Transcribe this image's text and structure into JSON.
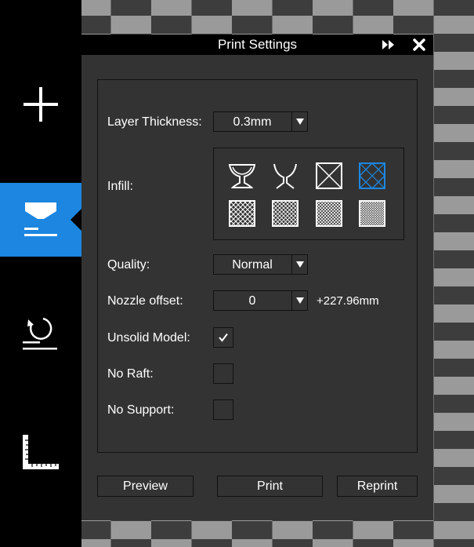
{
  "window": {
    "title": "Print Settings"
  },
  "sidebar": {
    "items": [
      {
        "icon": "plus-icon",
        "active": false
      },
      {
        "icon": "print-settings-icon",
        "active": true
      },
      {
        "icon": "reset-rotate-icon",
        "active": false
      },
      {
        "icon": "ruler-icon",
        "active": false
      }
    ]
  },
  "settings": {
    "layer_thickness": {
      "label": "Layer Thickness:",
      "value": "0.3mm"
    },
    "infill": {
      "label": "Infill:",
      "options": [
        {
          "icon": "hollow-goblet-icon",
          "selected": false
        },
        {
          "icon": "thin-goblet-icon",
          "selected": false
        },
        {
          "icon": "crossed-square-icon",
          "selected": false
        },
        {
          "icon": "diamond-square-icon",
          "selected": true
        },
        {
          "icon": "coarse-grid-icon",
          "selected": false
        },
        {
          "icon": "medium-grid-icon",
          "selected": false
        },
        {
          "icon": "fine-grid-icon",
          "selected": false
        },
        {
          "icon": "dense-grid-icon",
          "selected": false
        }
      ]
    },
    "quality": {
      "label": "Quality:",
      "value": "Normal"
    },
    "nozzle_offset": {
      "label": "Nozzle offset:",
      "value": "0",
      "readout": "+227.96mm"
    },
    "unsolid_model": {
      "label": "Unsolid Model:",
      "checked": true
    },
    "no_raft": {
      "label": "No Raft:",
      "checked": false
    },
    "no_support": {
      "label": "No Support:",
      "checked": false
    }
  },
  "buttons": {
    "preview": "Preview",
    "print": "Print",
    "reprint": "Reprint"
  },
  "colors": {
    "accent": "#1c86e0",
    "panel": "#333333",
    "titlebar": "#000000"
  }
}
